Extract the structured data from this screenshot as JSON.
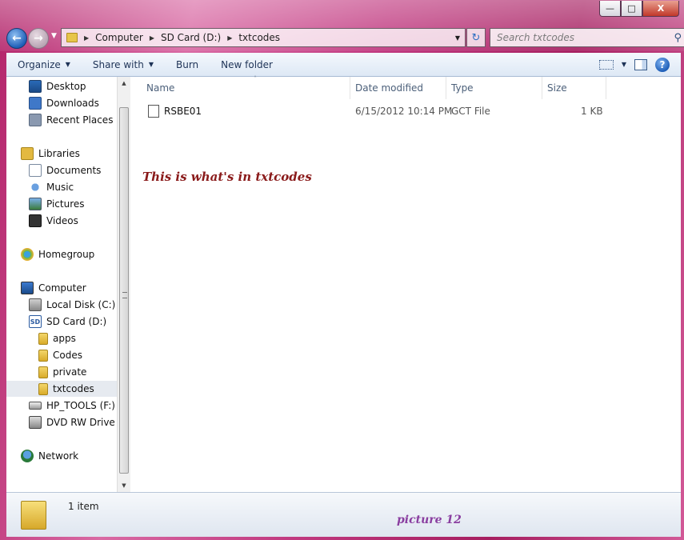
{
  "window": {
    "minimize_label": "—",
    "maximize_label": "□",
    "close_label": "X"
  },
  "address_bar": {
    "crumbs": [
      "Computer",
      "SD Card (D:)",
      "txtcodes"
    ]
  },
  "search": {
    "placeholder": "Search txtcodes"
  },
  "toolbar": {
    "organize": "Organize",
    "share_with": "Share with",
    "burn": "Burn",
    "new_folder": "New folder"
  },
  "sidebar": {
    "favorites": [
      "Desktop",
      "Downloads",
      "Recent Places"
    ],
    "libraries": {
      "label": "Libraries",
      "items": [
        "Documents",
        "Music",
        "Pictures",
        "Videos"
      ]
    },
    "homegroup": "Homegroup",
    "computer": {
      "label": "Computer",
      "local_disk": "Local Disk (C:)",
      "sd_card": "SD Card (D:)",
      "sd_card_icon_text": "SD",
      "folders": [
        "apps",
        "Codes",
        "private",
        "txtcodes"
      ],
      "hp_tools": "HP_TOOLS (F:)",
      "dvd": "DVD RW Drive (G"
    },
    "network": "Network"
  },
  "columns": {
    "name": "Name",
    "date_modified": "Date modified",
    "type": "Type",
    "size": "Size"
  },
  "files": [
    {
      "name": "RSBE01",
      "date": "6/15/2012 10:14 PM",
      "type": "GCT File",
      "size": "1 KB"
    }
  ],
  "annotation": "This is what's in txtcodes",
  "status": {
    "item_count": "1 item",
    "picture_label": "picture 12"
  },
  "colors": {
    "frame": "#c0387f",
    "annotation": "#8a1a1a",
    "picture_label": "#8a3ea0",
    "selected_row": "#e6eaf0"
  }
}
